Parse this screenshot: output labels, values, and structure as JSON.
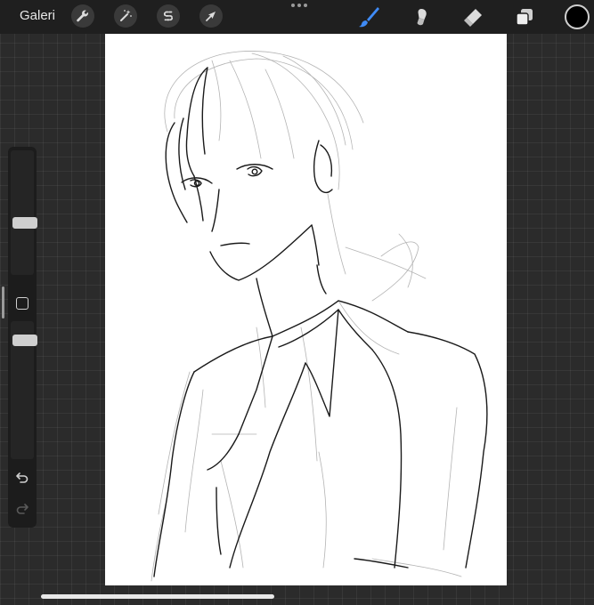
{
  "toolbar": {
    "gallery_label": "Galeri",
    "actions_icon": "wrench-icon",
    "adjustments_icon": "magic-wand-icon",
    "selection_icon": "selection-s-icon",
    "transform_icon": "arrow-cursor-icon",
    "more_icon": "more-dots-icon",
    "brush_icon": "brush-icon",
    "smudge_icon": "smudge-icon",
    "eraser_icon": "eraser-icon",
    "layers_icon": "layers-icon",
    "active_tool": "brush",
    "current_color": "#000000",
    "accent_color": "#3f8bf6"
  },
  "sidebar": {
    "brush_size": 0.42,
    "brush_opacity": 0.72,
    "modify_icon": "square-icon",
    "undo_icon": "undo-icon",
    "redo_icon": "redo-icon"
  }
}
